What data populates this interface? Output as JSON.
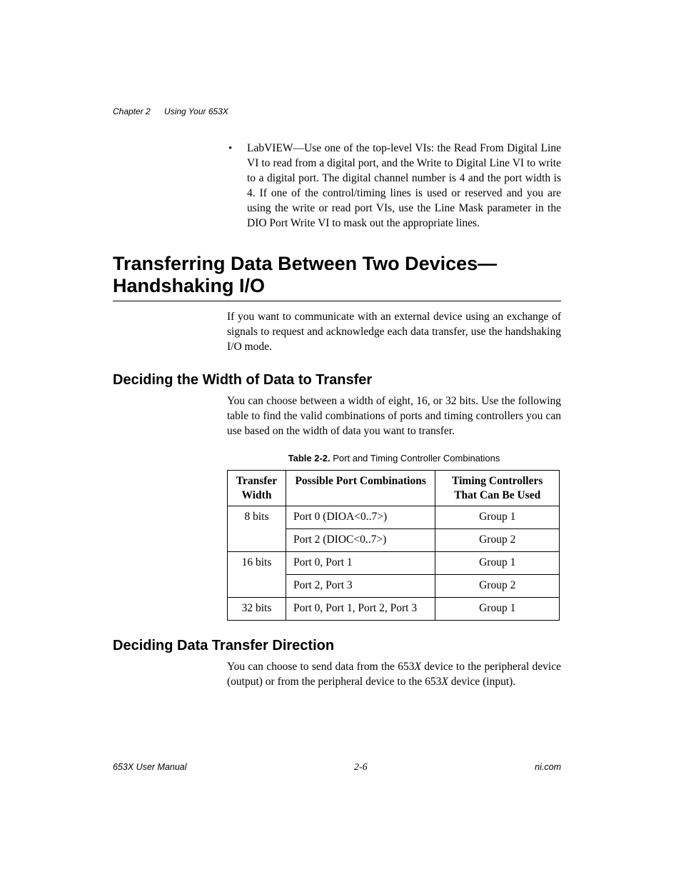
{
  "header": {
    "chapter_label": "Chapter 2",
    "chapter_title": "Using Your 653X"
  },
  "bullet": {
    "text": "LabVIEW—Use one of the top-level VIs: the Read From Digital Line VI to read from a digital port, and the Write to Digital Line VI to write to a digital port. The digital channel number is 4 and the port width is 4. If one of the control/timing lines is used or reserved and you are using the write or read port VIs, use the Line Mask parameter in the DIO Port Write VI to mask out the appropriate lines."
  },
  "section": {
    "title": "Transferring Data Between Two Devices—Handshaking I/O",
    "intro": "If you want to communicate with an external device using an exchange of signals to request and acknowledge each data transfer, use the handshaking I/O mode."
  },
  "sub1": {
    "title": "Deciding the Width of Data to Transfer",
    "body": "You can choose between a width of eight, 16, or 32 bits. Use the following table to find the valid combinations of ports and timing controllers you can use based on the width of data you want to transfer."
  },
  "table": {
    "caption_label": "Table 2-2.",
    "caption_text": "Port and Timing Controller Combinations",
    "headers": {
      "c1": "Transfer Width",
      "c2": "Possible Port Combinations",
      "c3": "Timing Controllers That Can Be Used"
    },
    "rows": [
      {
        "width": "8 bits",
        "ports": "Port 0 (DIOA<0..7>)",
        "tc": "Group 1"
      },
      {
        "width": "",
        "ports": "Port 2 (DIOC<0..7>)",
        "tc": "Group 2"
      },
      {
        "width": "16 bits",
        "ports": "Port 0, Port 1",
        "tc": "Group 1"
      },
      {
        "width": "",
        "ports": "Port 2, Port 3",
        "tc": "Group 2"
      },
      {
        "width": "32 bits",
        "ports": "Port 0, Port 1, Port 2, Port 3",
        "tc": "Group 1"
      }
    ]
  },
  "sub2": {
    "title": "Deciding Data Transfer Direction",
    "body_pre": "You can choose to send data from the 653",
    "body_mid": " device to the peripheral device (output) or from the peripheral device to the 653",
    "body_post": " device (input).",
    "italic_x": "X"
  },
  "footer": {
    "left": "653X User Manual",
    "center": "2-6",
    "right": "ni.com"
  }
}
